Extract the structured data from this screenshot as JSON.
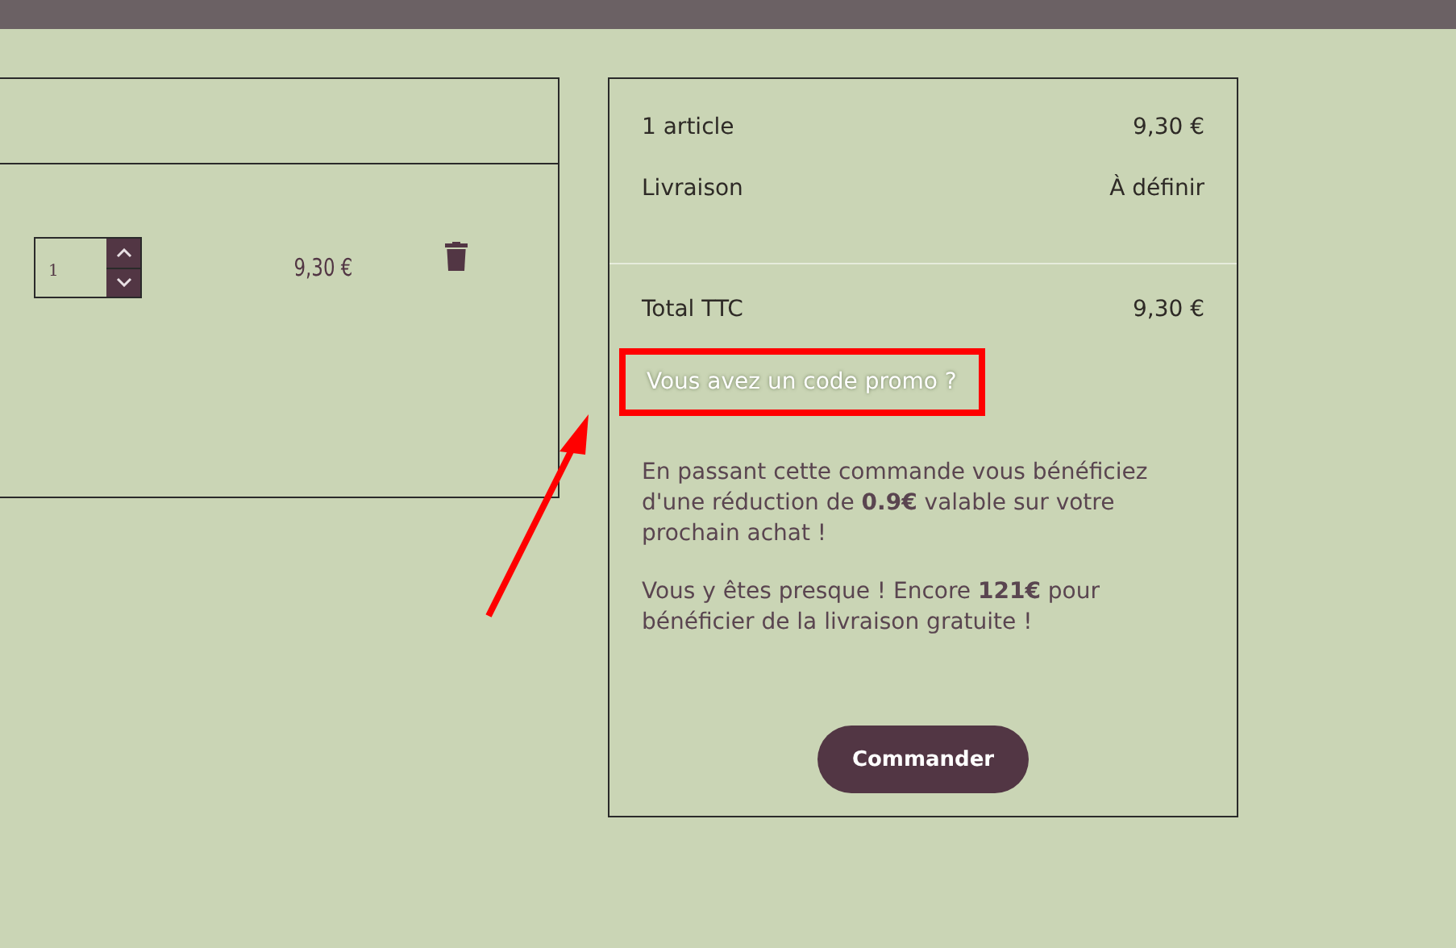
{
  "cart_item": {
    "quantity": "1",
    "price": "9,30 €"
  },
  "summary": {
    "lines": [
      {
        "label": "1 article",
        "value": "9,30 €"
      },
      {
        "label": "Livraison",
        "value": "À définir"
      }
    ],
    "total": {
      "label": "Total TTC",
      "value": "9,30 €"
    },
    "promo_link": {
      "text": "Vous avez un code promo ?",
      "highlighted": true
    },
    "messages": [
      "En passant cette commande vous bénéficiez d'une réduction de **0.9€** valable sur votre prochain achat !",
      "Vous y êtes presque ! Encore **121€** pour bénéficier de la livraison gratuite !"
    ],
    "order_button": "Commander"
  }
}
